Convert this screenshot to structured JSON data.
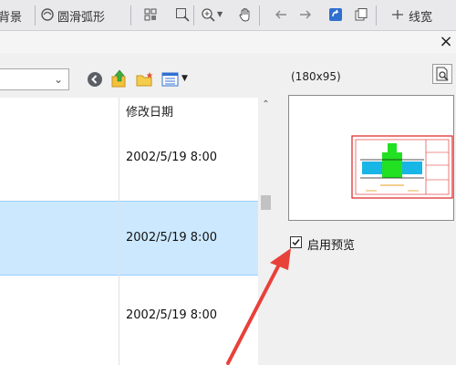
{
  "toolbar": {
    "label_background": "背景",
    "label_smooth_arc": "圆滑弧形",
    "label_line_width": "线宽"
  },
  "dialog": {
    "close_glyph": "×"
  },
  "file_list": {
    "column_modified": "修改日期",
    "rows": [
      {
        "date": "2002/5/19 8:00"
      },
      {
        "date": "2002/5/19 8:00"
      },
      {
        "date": "2002/5/19 8:00"
      }
    ]
  },
  "preview": {
    "size_text": "(180x95)",
    "enable_label": "启用预览",
    "enable_checked": true
  },
  "colors": {
    "selection": "#cce8ff",
    "annotation_arrow": "#e8413a",
    "drawing_frame": "#e02020",
    "drawing_fill": "#22e022",
    "drawing_cyan": "#18b6e6"
  },
  "icons": [
    "back-icon",
    "up-folder-icon",
    "new-folder-icon",
    "view-menu-icon",
    "zoom-icon",
    "hand-icon",
    "arrow-left-icon",
    "arrow-right-icon",
    "preview-magnifier-icon"
  ]
}
